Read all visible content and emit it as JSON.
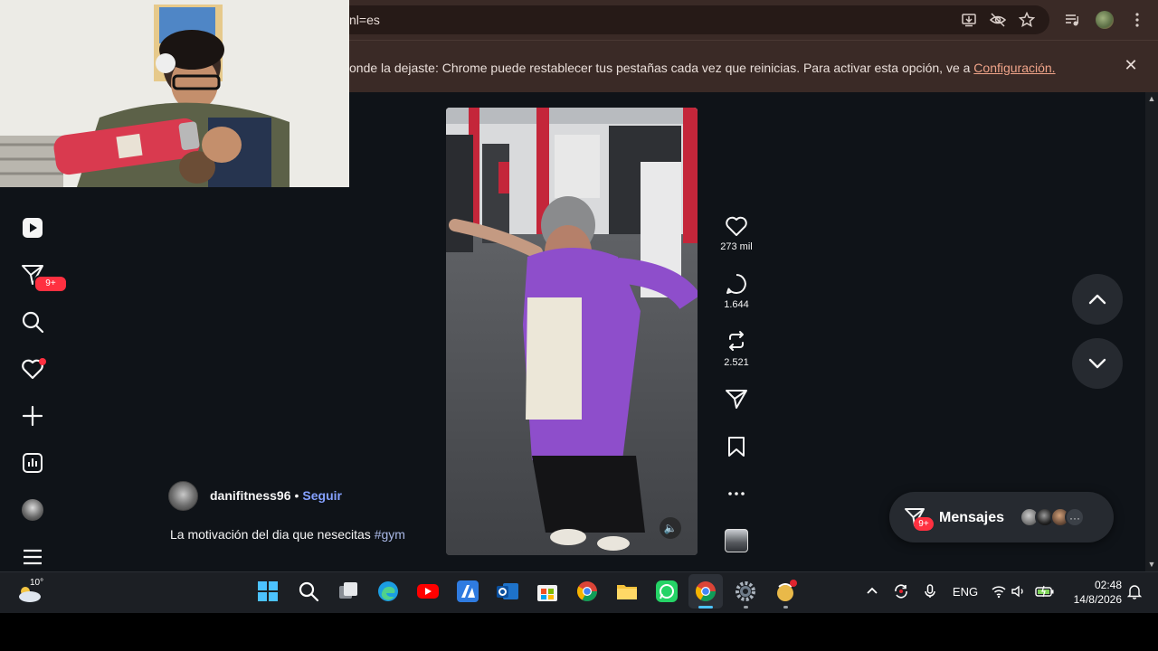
{
  "browser": {
    "url_visible": "nl=es",
    "infobar_text": "onde la dejaste: Chrome puede restablecer tus pestañas cada vez que reinicias. Para activar esta opción, ve a",
    "infobar_link": "Configuración.",
    "infobar_close": "✕"
  },
  "sidebar": {
    "items": [
      {
        "name": "reels",
        "icon": "reels-icon"
      },
      {
        "name": "messages",
        "icon": "direct-icon",
        "badge": "9+"
      },
      {
        "name": "search",
        "icon": "search-icon"
      },
      {
        "name": "notifications",
        "icon": "heart-icon"
      },
      {
        "name": "create",
        "icon": "plus-icon"
      },
      {
        "name": "dashboard",
        "icon": "chart-icon"
      },
      {
        "name": "profile",
        "icon": "avatar"
      },
      {
        "name": "more",
        "icon": "menu-icon"
      }
    ]
  },
  "post": {
    "username": "danifitness96",
    "separator": "•",
    "follow_label": "Seguir",
    "caption_text": "La motivación del dia que nesecitas",
    "hashtag": "#gym",
    "mute_icon": "🔈"
  },
  "actions": {
    "likes": "273 mil",
    "comments": "1.644",
    "reposts": "2.521"
  },
  "messages": {
    "label": "Mensajes",
    "badge": "9+",
    "more": "···"
  },
  "taskbar": {
    "temperature": "10°",
    "language": "ENG",
    "time": "02:48",
    "date": "14/8/2026"
  },
  "colors": {
    "accent_follow": "#85a1ff",
    "badge_red": "#ff3040",
    "infobar_link": "#f0a489"
  }
}
